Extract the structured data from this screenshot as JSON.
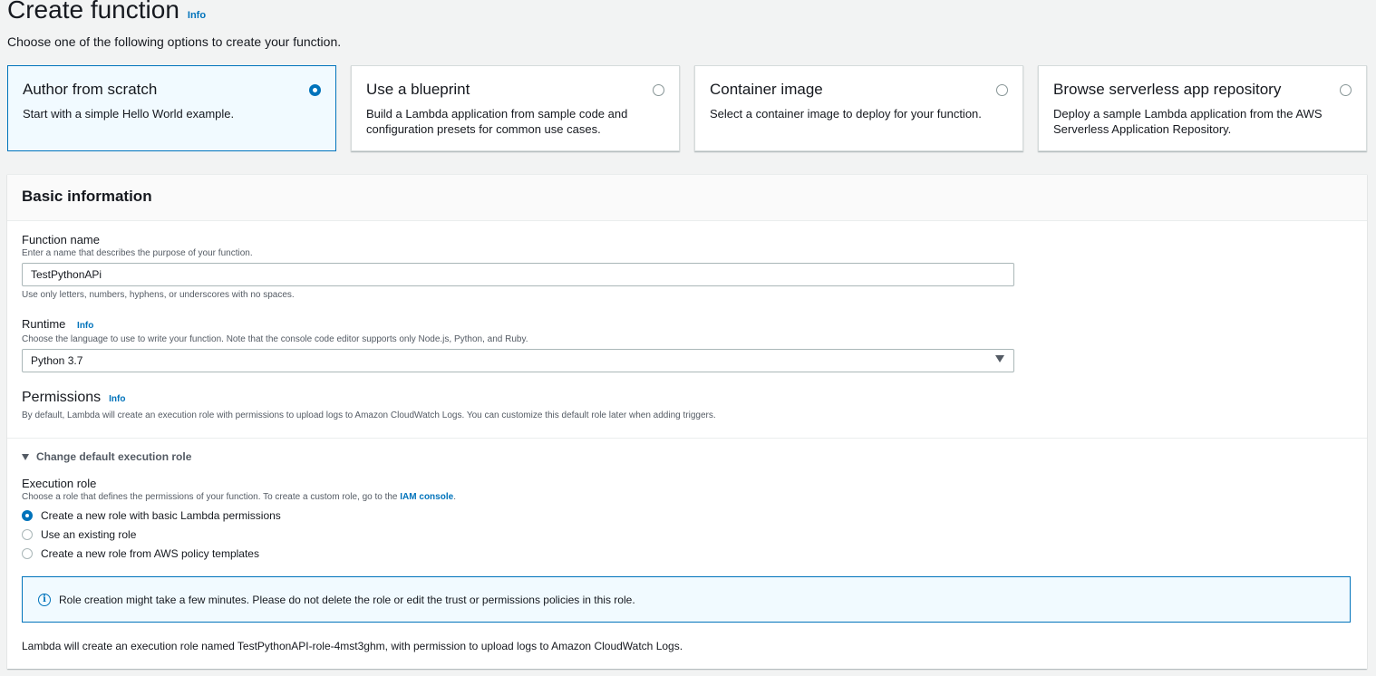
{
  "header": {
    "title": "Create function",
    "info": "Info",
    "subtitle": "Choose one of the following options to create your function."
  },
  "options": [
    {
      "title": "Author from scratch",
      "desc": "Start with a simple Hello World example.",
      "selected": true
    },
    {
      "title": "Use a blueprint",
      "desc": "Build a Lambda application from sample code and configuration presets for common use cases.",
      "selected": false
    },
    {
      "title": "Container image",
      "desc": "Select a container image to deploy for your function.",
      "selected": false
    },
    {
      "title": "Browse serverless app repository",
      "desc": "Deploy a sample Lambda application from the AWS Serverless Application Repository.",
      "selected": false
    }
  ],
  "basic": {
    "title": "Basic information",
    "function_name": {
      "label": "Function name",
      "desc": "Enter a name that describes the purpose of your function.",
      "value": "TestPythonAPi",
      "hint": "Use only letters, numbers, hyphens, or underscores with no spaces."
    },
    "runtime": {
      "label": "Runtime",
      "info": "Info",
      "desc": "Choose the language to use to write your function. Note that the console code editor supports only Node.js, Python, and Ruby.",
      "value": "Python 3.7"
    },
    "permissions": {
      "title": "Permissions",
      "info": "Info",
      "desc": "By default, Lambda will create an execution role with permissions to upload logs to Amazon CloudWatch Logs. You can customize this default role later when adding triggers."
    },
    "exec_role": {
      "expander": "Change default execution role",
      "label": "Execution role",
      "desc_prefix": "Choose a role that defines the permissions of your function. To create a custom role, go to the",
      "desc_link": "IAM console",
      "desc_suffix": ".",
      "options": [
        {
          "label": "Create a new role with basic Lambda permissions",
          "selected": true
        },
        {
          "label": "Use an existing role",
          "selected": false
        },
        {
          "label": "Create a new role from AWS policy templates",
          "selected": false
        }
      ]
    },
    "alert": "Role creation might take a few minutes. Please do not delete the role or edit the trust or permissions policies in this role.",
    "note": "Lambda will create an execution role named TestPythonAPI-role-4mst3ghm, with permission to upload logs to Amazon CloudWatch Logs."
  },
  "colors": {
    "accent": "#0073bb",
    "selected_bg": "#f1faff"
  }
}
